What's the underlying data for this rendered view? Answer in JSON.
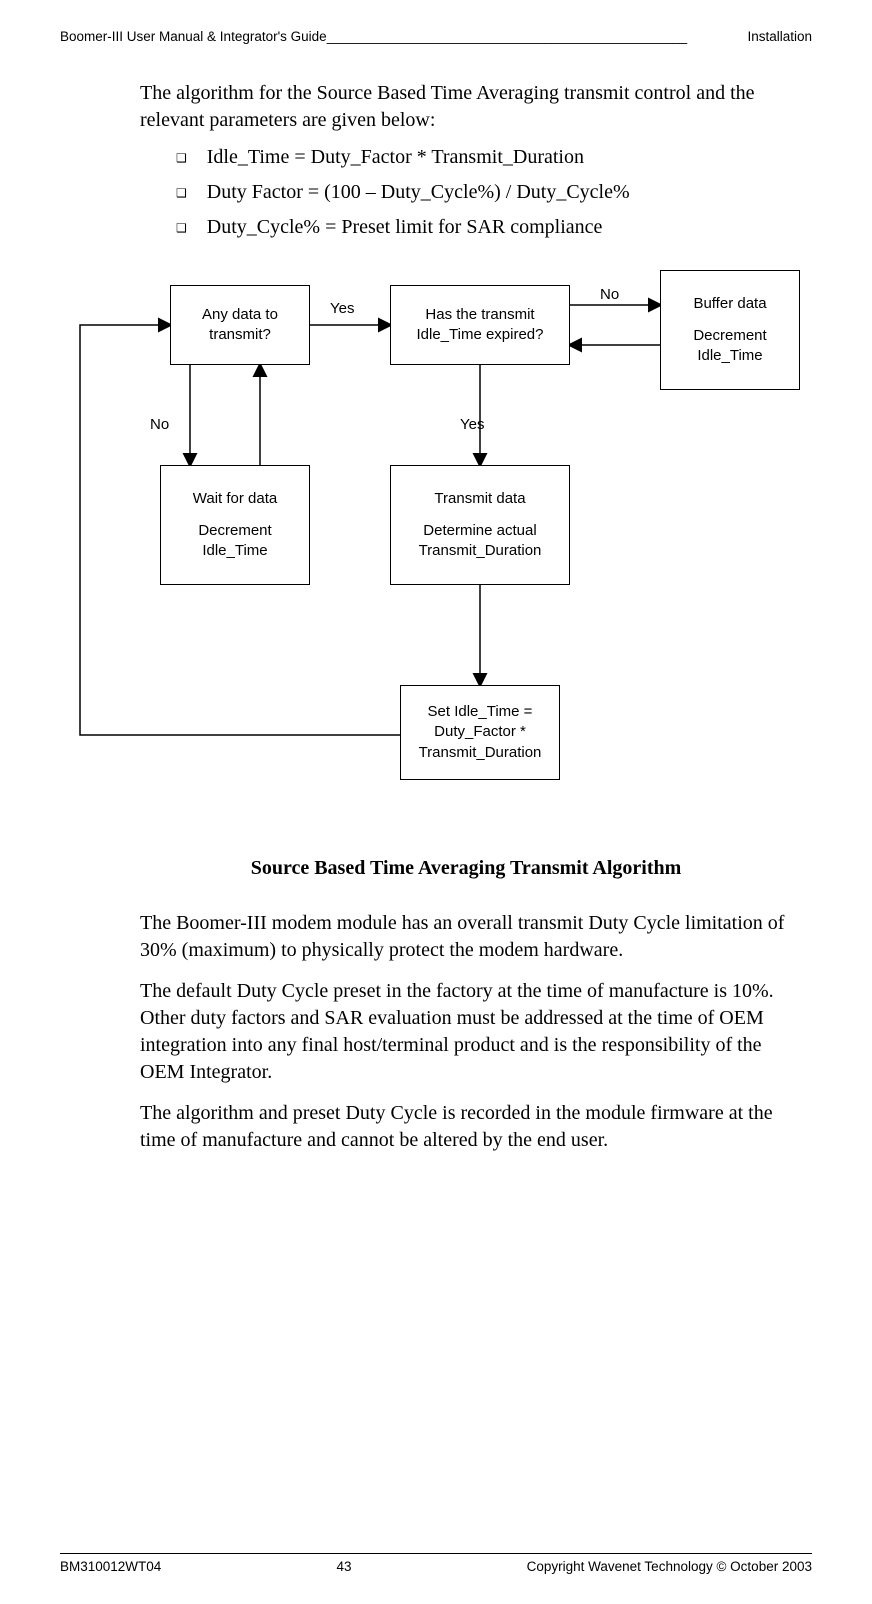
{
  "header": {
    "left": "Boomer-III User Manual & Integrator's Guide",
    "right": "Installation",
    "filler": "________________________________________________"
  },
  "intro": "The algorithm for the Source Based Time Averaging transmit control and the relevant parameters are given below:",
  "bullets": {
    "glyph": "❑",
    "items": [
      "Idle_Time = Duty_Factor * Transmit_Duration",
      "Duty Factor = (100 – Duty_Cycle%) / Duty_Cycle%",
      "Duty_Cycle% = Preset limit for SAR compliance"
    ]
  },
  "diagram": {
    "nodes": {
      "any_data": {
        "l1": "Any data to",
        "l2": "transmit?"
      },
      "has_idle": {
        "l1": "Has the transmit",
        "l2": "Idle_Time expired?"
      },
      "buffer": {
        "l1": "Buffer data",
        "l2": "",
        "l3": "Decrement",
        "l4": "Idle_Time"
      },
      "wait": {
        "l1": "Wait for data",
        "l2": "",
        "l3": "Decrement",
        "l4": "Idle_Time"
      },
      "transmit": {
        "l1": "Transmit data",
        "l2": "",
        "l3": "Determine actual",
        "l4": "Transmit_Duration"
      },
      "set_idle": {
        "l1": "Set Idle_Time =",
        "l2": "Duty_Factor *",
        "l3": "Transmit_Duration"
      }
    },
    "labels": {
      "yes1": "Yes",
      "no1": "No",
      "yes2": "Yes",
      "no2": "No"
    }
  },
  "caption": "Source Based Time Averaging Transmit Algorithm",
  "body2": {
    "p1": "The Boomer-III modem module has an overall transmit Duty Cycle limitation of 30% (maximum) to physically protect the modem hardware.",
    "p2": "The default Duty Cycle preset in the factory at the time of manufacture is 10%.  Other duty factors and SAR evaluation must be addressed at the time of OEM integration into any final host/terminal product and is the responsibility of the OEM Integrator.",
    "p3": "The algorithm and preset Duty Cycle is recorded in the module firmware at the time of manufacture and cannot be altered by the end user."
  },
  "footer": {
    "left": "BM310012WT04",
    "center": "43",
    "right": "Copyright Wavenet Technology © October 2003"
  }
}
